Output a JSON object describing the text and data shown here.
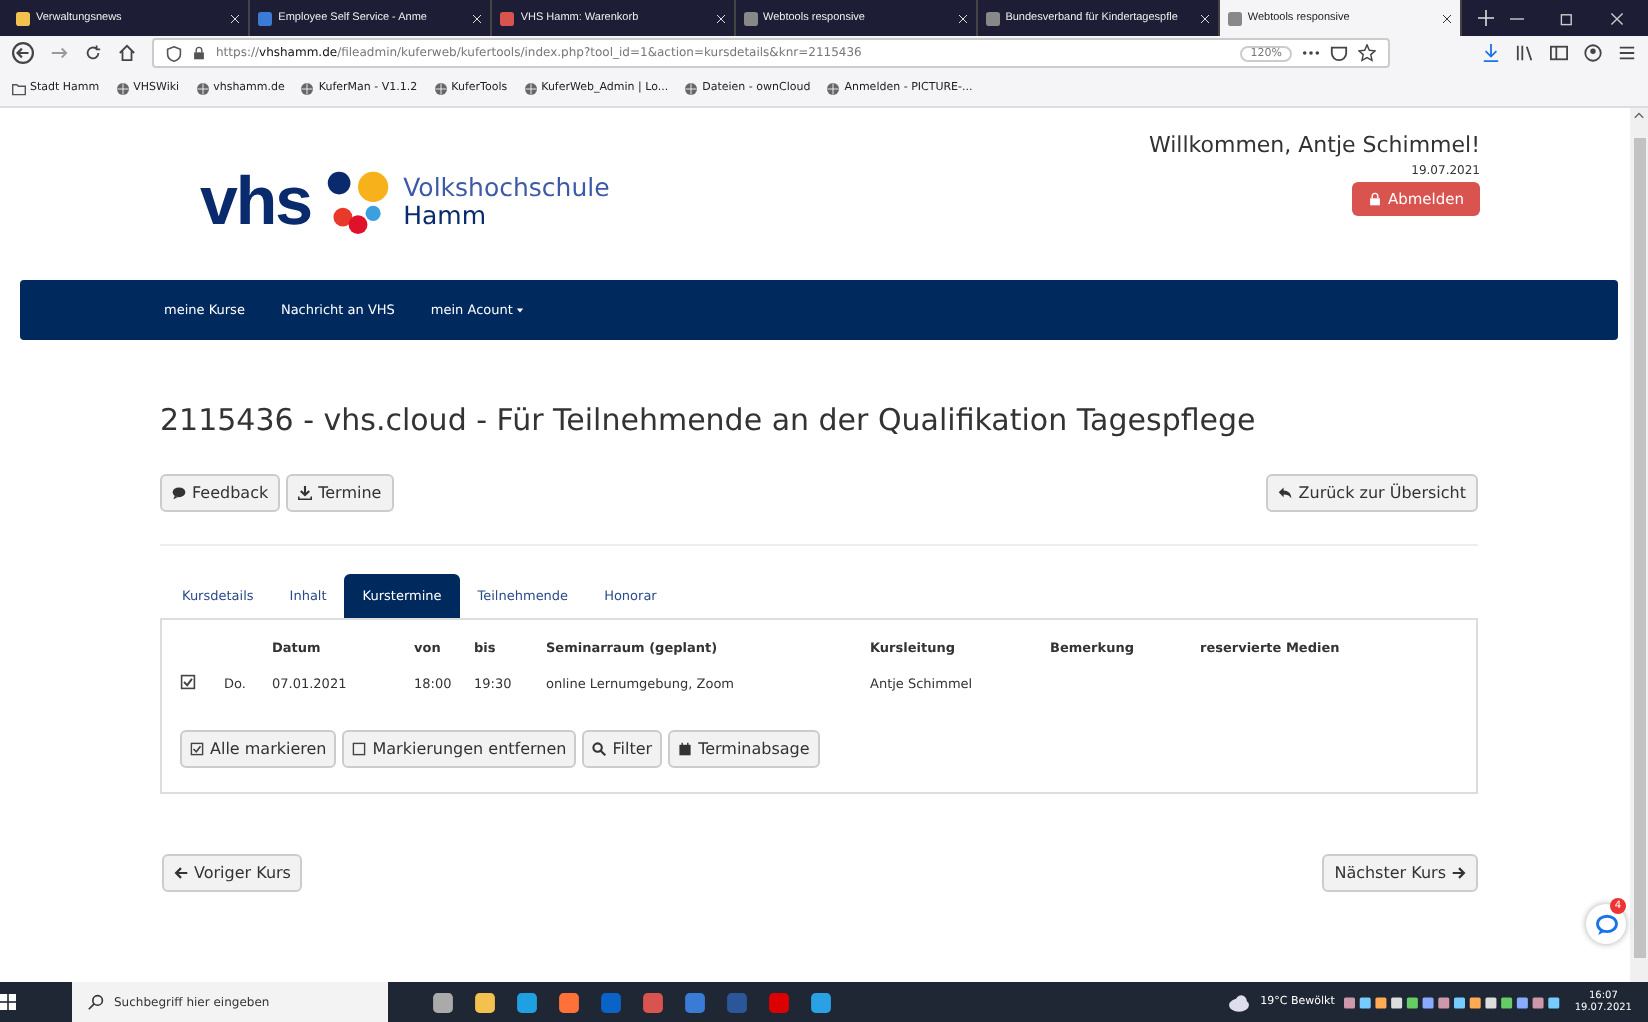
{
  "browser": {
    "tabs": [
      {
        "title": "Verwaltungsnews",
        "selected": false
      },
      {
        "title": "Employee Self Service - Anme",
        "selected": false
      },
      {
        "title": "VHS Hamm: Warenkorb",
        "selected": false
      },
      {
        "title": "Webtools responsive",
        "selected": false
      },
      {
        "title": "Bundesverband für Kindertagespfle",
        "selected": false
      },
      {
        "title": "Webtools responsive",
        "selected": true
      }
    ],
    "url_prefix": "https://",
    "url_host": "vhshamm.de",
    "url_path": "/fileadmin/kuferweb/kufertools/index.php?tool_id=1&action=kursdetails&knr=2115436",
    "zoom": "120%",
    "bookmarks": [
      "Stadt Hamm",
      "VHSWiki",
      "vhshamm.de",
      "KuferMan - V1.1.2",
      "KuferTools",
      "KuferWeb_Admin | Lo...",
      "Dateien - ownCloud",
      "Anmelden - PICTURE-..."
    ]
  },
  "header": {
    "logo_text": "vhs",
    "org_line1": "Volkshochschule",
    "org_line2": "Hamm",
    "welcome": "Willkommen, Antje Schimmel!",
    "date": "19.07.2021",
    "logout": "Abmelden"
  },
  "nav": [
    "meine Kurse",
    "Nachricht an VHS",
    "mein Acount"
  ],
  "title": "2115436 - vhs.cloud - Für Teilnehmende an der Qualifikation Tagespflege",
  "actions": [
    "Feedback",
    "Termine"
  ],
  "back": "Zurück zur Übersicht",
  "course_tabs": [
    {
      "label": "Kursdetails",
      "selected": false
    },
    {
      "label": "Inhalt",
      "selected": false
    },
    {
      "label": "Kurstermine",
      "selected": true
    },
    {
      "label": "Teilnehmende",
      "selected": false
    },
    {
      "label": "Honorar",
      "selected": false
    }
  ],
  "table": {
    "columns": [
      "Datum",
      "von",
      "bis",
      "Seminarraum (geplant)",
      "Kursleitung",
      "Bemerkung",
      "reservierte Medien"
    ],
    "rows": [
      {
        "checked": true,
        "day": "Do.",
        "cells": [
          "07.01.2021",
          "18:00",
          "19:30",
          "online Lernumgebung, Zoom",
          "Antje Schimmel"
        ]
      }
    ]
  },
  "table_buttons": [
    "Alle markieren",
    "Markierungen entfernen",
    "Filter",
    "Terminabsage"
  ],
  "prev": "Voriger Kurs",
  "next": "Nächster Kurs",
  "chat_badge": "4",
  "taskbar": {
    "search_placeholder": "Suchbegriff hier eingeben",
    "weather": "19°C  Bewölkt",
    "time": "16:07",
    "date": "19.07.2021"
  }
}
